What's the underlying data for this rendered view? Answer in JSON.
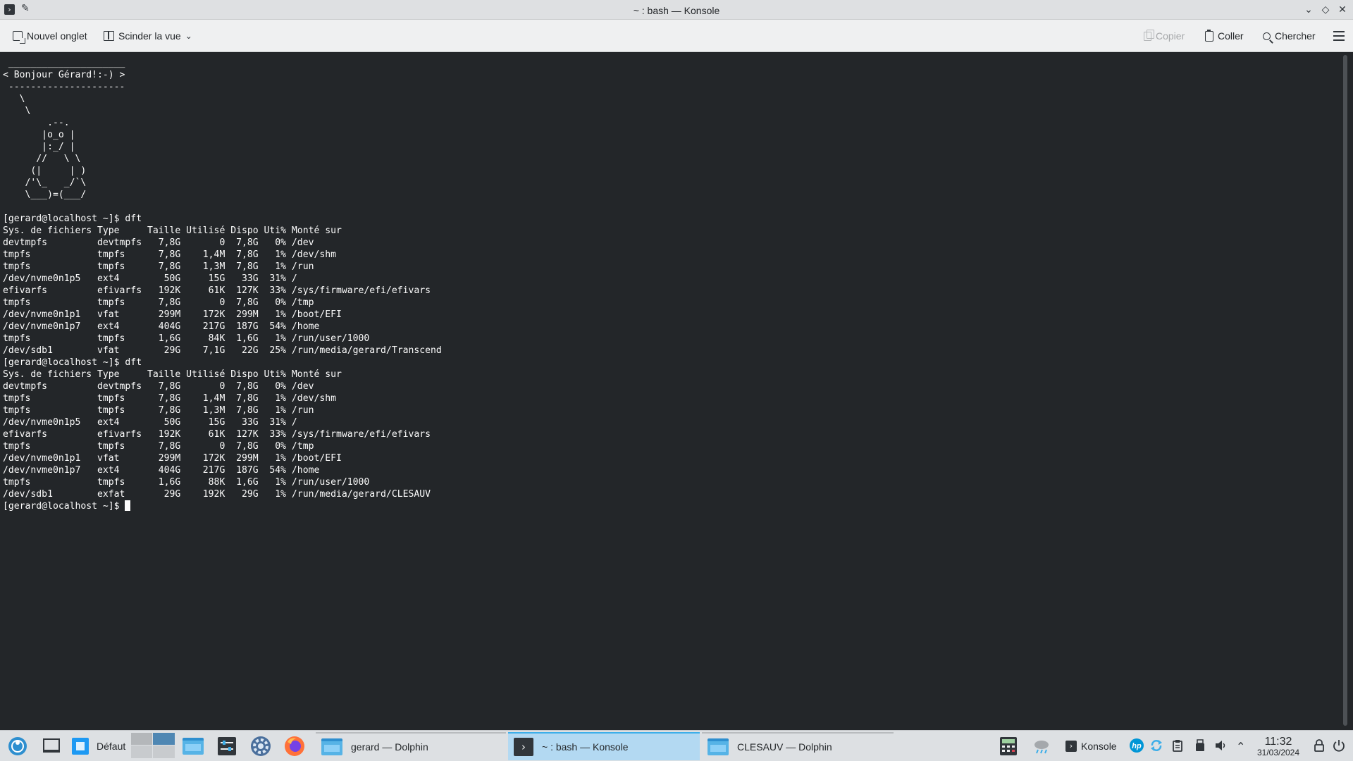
{
  "window": {
    "title": "~ : bash — Konsole"
  },
  "toolbar": {
    "new_tab": "Nouvel onglet",
    "split_view": "Scinder la vue",
    "copy": "Copier",
    "paste": "Coller",
    "search": "Chercher"
  },
  "terminal": {
    "lines": [
      " _____________________",
      "< Bonjour Gérard!:-) >",
      " ---------------------",
      "   \\",
      "    \\",
      "        .--.",
      "       |o_o |",
      "       |:_/ |",
      "      //   \\ \\",
      "     (|     | )",
      "    /'\\_   _/`\\",
      "    \\___)=(___/",
      "",
      "[gerard@localhost ~]$ dft",
      "Sys. de fichiers Type     Taille Utilisé Dispo Uti% Monté sur",
      "devtmpfs         devtmpfs   7,8G       0  7,8G   0% /dev",
      "tmpfs            tmpfs      7,8G    1,4M  7,8G   1% /dev/shm",
      "tmpfs            tmpfs      7,8G    1,3M  7,8G   1% /run",
      "/dev/nvme0n1p5   ext4        50G     15G   33G  31% /",
      "efivarfs         efivarfs   192K     61K  127K  33% /sys/firmware/efi/efivars",
      "tmpfs            tmpfs      7,8G       0  7,8G   0% /tmp",
      "/dev/nvme0n1p1   vfat       299M    172K  299M   1% /boot/EFI",
      "/dev/nvme0n1p7   ext4       404G    217G  187G  54% /home",
      "tmpfs            tmpfs      1,6G     84K  1,6G   1% /run/user/1000",
      "/dev/sdb1        vfat        29G    7,1G   22G  25% /run/media/gerard/Transcend",
      "[gerard@localhost ~]$ dft",
      "Sys. de fichiers Type     Taille Utilisé Dispo Uti% Monté sur",
      "devtmpfs         devtmpfs   7,8G       0  7,8G   0% /dev",
      "tmpfs            tmpfs      7,8G    1,4M  7,8G   1% /dev/shm",
      "tmpfs            tmpfs      7,8G    1,3M  7,8G   1% /run",
      "/dev/nvme0n1p5   ext4        50G     15G   33G  31% /",
      "efivarfs         efivarfs   192K     61K  127K  33% /sys/firmware/efi/efivars",
      "tmpfs            tmpfs      7,8G       0  7,8G   0% /tmp",
      "/dev/nvme0n1p1   vfat       299M    172K  299M   1% /boot/EFI",
      "/dev/nvme0n1p7   ext4       404G    217G  187G  54% /home",
      "tmpfs            tmpfs      1,6G     88K  1,6G   1% /run/user/1000",
      "/dev/sdb1        exfat       29G    192K   29G   1% /run/media/gerard/CLESAUV"
    ],
    "prompt": "[gerard@localhost ~]$ "
  },
  "taskbar": {
    "activity_label": "Défaut",
    "tasks": [
      {
        "label": "gerard — Dolphin",
        "icon": "folder-icon"
      },
      {
        "label": "~ : bash — Konsole",
        "icon": "konsole-icon"
      },
      {
        "label": "CLESAUV — Dolphin",
        "icon": "folder-icon"
      }
    ],
    "tray": {
      "konsole_label": "Konsole"
    },
    "clock": {
      "time": "11:32",
      "date": "31/03/2024"
    }
  },
  "colors": {
    "terminal_bg": "#232629",
    "terminal_fg": "#fcfcfc",
    "accent": "#3daee9",
    "active_task_bg": "#b3d9f2"
  }
}
